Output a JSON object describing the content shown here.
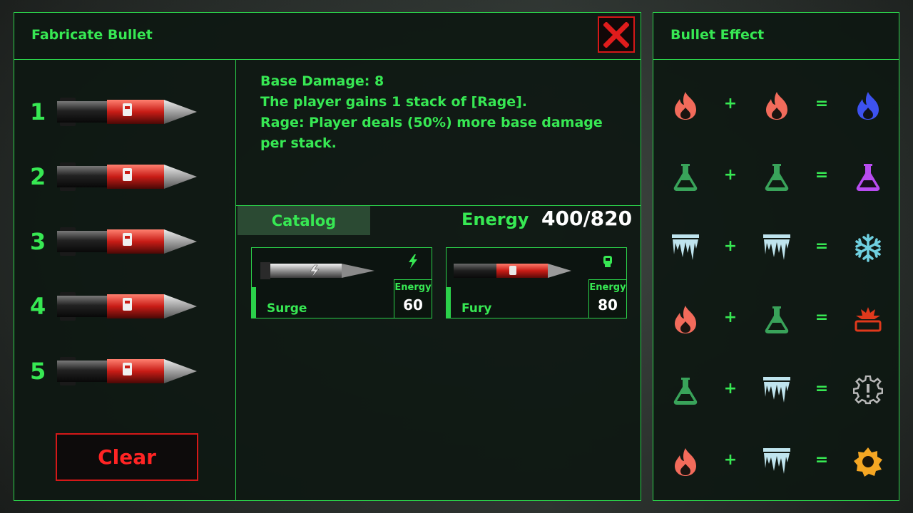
{
  "fabricate": {
    "title": "Fabricate Bullet",
    "close_label": "X",
    "slots": [
      {
        "number": "1",
        "bullet": "Fury"
      },
      {
        "number": "2",
        "bullet": "Fury"
      },
      {
        "number": "3",
        "bullet": "Fury"
      },
      {
        "number": "4",
        "bullet": "Fury"
      },
      {
        "number": "5",
        "bullet": "Fury"
      }
    ],
    "clear_label": "Clear"
  },
  "description": {
    "line1": "Base Damage: 8",
    "line2": "The player gains 1 stack of [Rage].",
    "line3": "Rage: Player deals (50%) more base damage per stack."
  },
  "catalog": {
    "tab_label": "Catalog",
    "energy_label": "Energy",
    "energy_value": "400/820",
    "cards": [
      {
        "name": "Surge",
        "energy_label": "Energy",
        "cost": "60",
        "icon": "lightning-icon"
      },
      {
        "name": "Fury",
        "energy_label": "Energy",
        "cost": "80",
        "icon": "rage-fist-icon"
      }
    ]
  },
  "effects": {
    "title": "Bullet Effect",
    "plus": "+",
    "equals": "=",
    "rows": [
      {
        "a": "fire-icon",
        "b": "fire-icon",
        "result": "blue-fire-icon"
      },
      {
        "a": "poison-flask-icon",
        "b": "poison-flask-icon",
        "result": "purple-flask-icon"
      },
      {
        "a": "ice-icon",
        "b": "ice-icon",
        "result": "snowflake-icon"
      },
      {
        "a": "fire-icon",
        "b": "poison-flask-icon",
        "result": "explosion-icon"
      },
      {
        "a": "poison-flask-icon",
        "b": "ice-icon",
        "result": "alert-gear-icon"
      },
      {
        "a": "fire-icon",
        "b": "ice-icon",
        "result": "sun-gear-icon"
      }
    ]
  },
  "colors": {
    "accent_green": "#37e853",
    "border_green": "#2bd14a",
    "danger_red": "#d51818",
    "fire": "#f26b5b",
    "poison": "#39a35a",
    "ice": "#bfe4ee",
    "blue_fire": "#3d52f0",
    "purple": "#b84cf0",
    "snowflake": "#6fd0e0",
    "explosion": "#e0391c",
    "gear_grey": "#b8b8b8",
    "sun_gear": "#f5a623"
  }
}
